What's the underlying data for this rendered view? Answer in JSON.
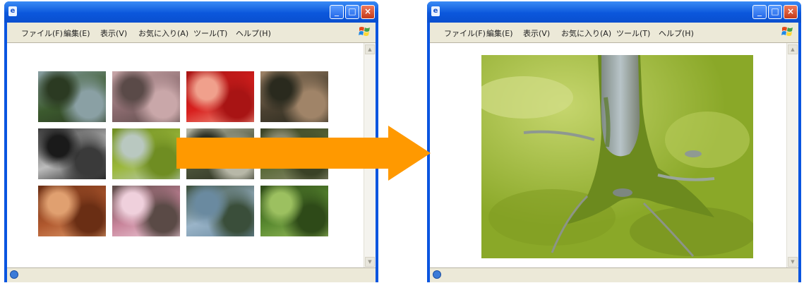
{
  "windows": [
    {
      "id": "gallery",
      "title": "",
      "menu": [
        "ファイル(F)",
        "編集(E)",
        "表示(V)",
        "お気に入り(A)",
        "ツール(T)",
        "ヘルプ(H)"
      ],
      "thumbnails": [
        {
          "subject": "garden-bridge",
          "colors": [
            "#3c5a2e",
            "#8aa0a4",
            "#2b3a22"
          ]
        },
        {
          "subject": "cherry-blossom",
          "colors": [
            "#8a6a6e",
            "#c9a7a9",
            "#5a4a48"
          ]
        },
        {
          "subject": "red-umbrella",
          "colors": [
            "#d8201e",
            "#a81414",
            "#f0a08c"
          ]
        },
        {
          "subject": "stepping-stones",
          "colors": [
            "#4a4030",
            "#a08468",
            "#2a2a1e"
          ]
        },
        {
          "subject": "stone-fountain",
          "colors": [
            "#bdbdbd",
            "#3a3a3a",
            "#1a1a1a"
          ]
        },
        {
          "subject": "moss-tree",
          "colors": [
            "#9bb83a",
            "#6f8d22",
            "#b9c8c0"
          ]
        },
        {
          "subject": "bamboo-grove",
          "colors": [
            "#4a5238",
            "#b8b8a8",
            "#2c2f22"
          ]
        },
        {
          "subject": "mossy-garden",
          "colors": [
            "#5a6a38",
            "#3a4226",
            "#8a8a70"
          ]
        },
        {
          "subject": "wooden-roof",
          "colors": [
            "#b0582e",
            "#6a2e14",
            "#e0a070"
          ]
        },
        {
          "subject": "pink-blossoms",
          "colors": [
            "#c8849a",
            "#5a4a46",
            "#efd0dc"
          ]
        },
        {
          "subject": "pond-landscape",
          "colors": [
            "#9ab4c8",
            "#3a4e3a",
            "#6a8aa0"
          ]
        },
        {
          "subject": "green-leaves",
          "colors": [
            "#5a8a30",
            "#2e4a18",
            "#9cc060"
          ]
        }
      ]
    },
    {
      "id": "viewer",
      "title": "",
      "menu": [
        "ファイル(F)",
        "編集(E)",
        "表示(V)",
        "お気に入り(A)",
        "ツール(T)",
        "ヘルプ(H)"
      ],
      "photo": {
        "subject": "moss-tree-enlarged",
        "colors": [
          "#9ab52c",
          "#6e8a1e",
          "#c2d07a",
          "#8f9a8e"
        ]
      }
    }
  ],
  "arrow": {
    "color": "#ff9900",
    "direction": "right"
  },
  "theme": {
    "titlebar": "#0a55e0",
    "menubar": "#ece9d8"
  }
}
